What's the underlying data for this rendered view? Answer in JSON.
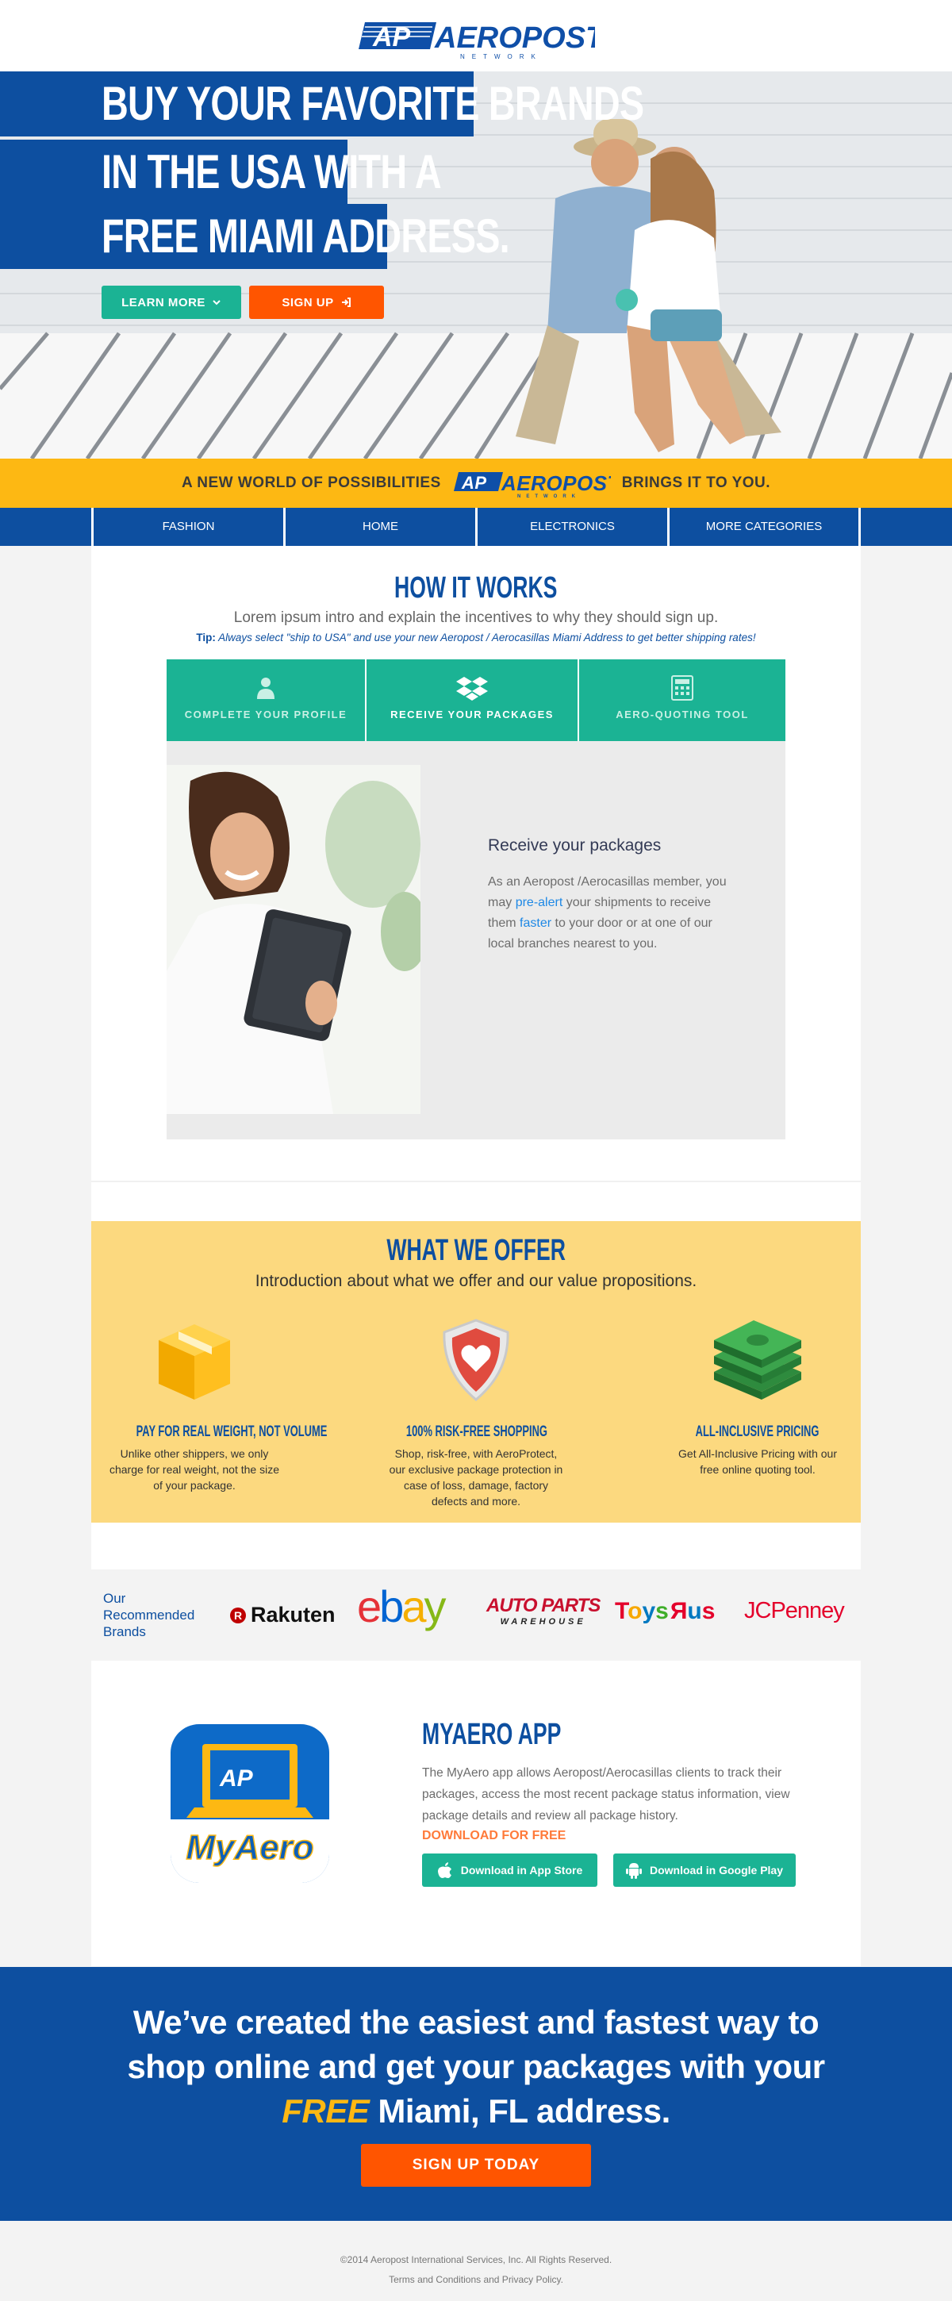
{
  "header": {
    "brand": "AEROPOST",
    "brand_sub": "NETWORK",
    "logo_mark": "AP"
  },
  "hero": {
    "line1": "BUY YOUR FAVORITE BRANDS",
    "line2": "IN THE USA WITH A",
    "line3": "FREE MIAMI ADDRESS.",
    "learn_more": "LEARN MORE",
    "sign_up": "SIGN UP"
  },
  "promo": {
    "left": "A NEW WORLD OF POSSIBILITIES",
    "right": "BRINGS IT TO YOU."
  },
  "nav": {
    "items": [
      "FASHION",
      "HOME",
      "ELECTRONICS",
      "MORE CATEGORIES"
    ]
  },
  "how_it_works": {
    "title": "HOW IT WORKS",
    "intro": "Lorem ipsum intro and explain the incentives to why they should sign up.",
    "tip_label": "Tip:",
    "tip_text": "Always select \"ship to USA\" and use your new Aeropost / Aerocasillas Miami Address to get better shipping rates!",
    "tabs": [
      "COMPLETE YOUR PROFILE",
      "RECEIVE YOUR PACKAGES",
      "AERO-QUOTING TOOL"
    ],
    "active_tab": 1,
    "panel": {
      "heading": "Receive your packages",
      "text1": "As an Aeropost /Aerocasillas member, you may",
      "link1": "pre-alert",
      "text2": "your shipments to receive them",
      "link2": "faster",
      "text3": "to your door or at one of our local branches nearest to you."
    }
  },
  "offer": {
    "title": "WHAT WE OFFER",
    "intro": "Introduction about what we offer and our value propositions.",
    "features": [
      {
        "title": "PAY FOR REAL WEIGHT, NOT VOLUME",
        "text": "Unlike other shippers, we only charge for real weight, not the size of your package.",
        "icon": "package-icon"
      },
      {
        "title": "100% RISK-FREE SHOPPING",
        "text": "Shop, risk-free, with AeroProtect, our exclusive package protection in case of loss, damage, factory defects and more.",
        "icon": "shield-heart-icon"
      },
      {
        "title": "ALL-INCLUSIVE PRICING",
        "text": "Get All-Inclusive Pricing with our free online quoting tool.",
        "icon": "money-stack-icon"
      }
    ]
  },
  "brands": {
    "label": "Our Recommended Brands",
    "items": [
      {
        "name": "Rakuten",
        "color": "#111111"
      },
      {
        "name": "ebay",
        "color": "#e53238"
      },
      {
        "name": "AUTO PARTS",
        "sub": "WAREHOUSE",
        "color": "#c8102e"
      },
      {
        "name": "Toys R Us",
        "color": "#0079c1"
      },
      {
        "name": "JCPenney",
        "color": "#e4002b"
      }
    ]
  },
  "app": {
    "title": "MYAERO APP",
    "icon_label": "MyAero",
    "body": "The MyAero app allows Aeropost/Aerocasillas clients to track their packages, access the most recent package status information, view package details and review all package history.",
    "cta": "DOWNLOAD FOR FREE",
    "app_store": "Download in App Store",
    "google_play": "Download in Google Play"
  },
  "banner": {
    "line1": "We’ve created the easiest and fastest way to",
    "line2": "shop online and get your packages with your",
    "free": "FREE",
    "line3_rest": "Miami, FL address.",
    "cta": "SIGN UP TODAY"
  },
  "footer": {
    "copyright": "©2014 Aeropost International Services, Inc. All Rights Reserved.",
    "links": "Terms and Conditions and Privacy Policy."
  },
  "colors": {
    "brand_blue": "#0d4fa0",
    "accent_teal": "#1bb394",
    "accent_orange": "#ff5500",
    "accent_yellow": "#fdb813"
  }
}
